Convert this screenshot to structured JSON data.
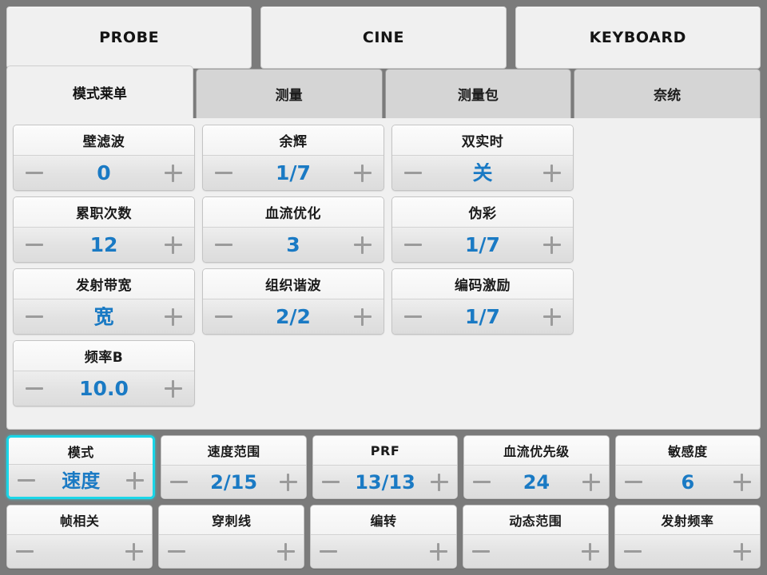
{
  "topbar": {
    "buttons": [
      {
        "label": "PROBE",
        "name": "probe-button"
      },
      {
        "label": "CINE",
        "name": "cine-button"
      },
      {
        "label": "KEYBOARD",
        "name": "keyboard-button"
      }
    ]
  },
  "tabs": [
    {
      "label": "模式莱单",
      "active": true
    },
    {
      "label": "测量",
      "active": false
    },
    {
      "label": "测量包",
      "active": false
    },
    {
      "label": "奈统",
      "active": false
    }
  ],
  "colors": {
    "background": "#7b7b7b",
    "panel": "#f0f0f0",
    "value_blue": "#1a7ac4",
    "highlight_cyan": "#1ad6e8",
    "tab_inactive": "#d5d5d5"
  },
  "controls": {
    "decrement_icon": "minus-icon",
    "increment_icon": "plus-icon"
  },
  "main_tiles": [
    {
      "label": "壁滤波",
      "value": "0"
    },
    {
      "label": "余辉",
      "value": "1/7"
    },
    {
      "label": "双实时",
      "value": "关"
    },
    {
      "label": "累职次数",
      "value": "12"
    },
    {
      "label": "血流优化",
      "value": "3"
    },
    {
      "label": "伪彩",
      "value": "1/7"
    },
    {
      "label": "发射带宽",
      "value": "宽"
    },
    {
      "label": "组织谐波",
      "value": "2/2"
    },
    {
      "label": "编码激励",
      "value": "1/7"
    },
    {
      "label": "频率B",
      "value": "10.0"
    }
  ],
  "bottom_rows": [
    [
      {
        "label": "模式",
        "value": "速度",
        "highlighted": true
      },
      {
        "label": "速度范围",
        "value": "2/15",
        "highlighted": false
      },
      {
        "label": "PRF",
        "value": "13/13",
        "highlighted": false
      },
      {
        "label": "血流优先级",
        "value": "24",
        "highlighted": false
      },
      {
        "label": "敏感度",
        "value": "6",
        "highlighted": false
      }
    ],
    [
      {
        "label": "帧相关",
        "value": "",
        "highlighted": false
      },
      {
        "label": "穿刺线",
        "value": "",
        "highlighted": false
      },
      {
        "label": "编转",
        "value": "",
        "highlighted": false
      },
      {
        "label": "动态范围",
        "value": "",
        "highlighted": false
      },
      {
        "label": "发射频率",
        "value": "",
        "highlighted": false
      }
    ]
  ]
}
